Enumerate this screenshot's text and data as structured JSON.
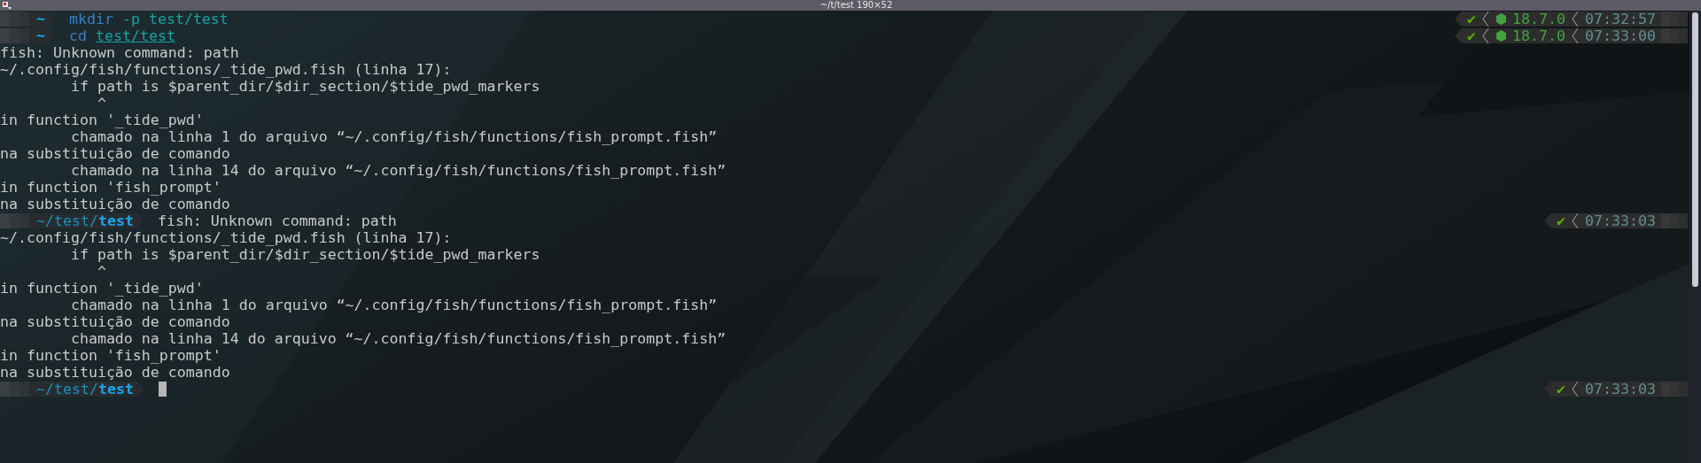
{
  "window": {
    "title": "~/t/test 190×52"
  },
  "lines": [
    {
      "kind": "prompt",
      "pwd": {
        "current": "~"
      },
      "tokens": [
        {
          "text": "mkdir",
          "kind": "command"
        },
        {
          "text": "-p test/test",
          "kind": "argument"
        }
      ],
      "right": [
        {
          "kind": "status",
          "text": "✔"
        },
        {
          "kind": "node",
          "text": "18.7.0"
        },
        {
          "kind": "time",
          "text": "07:32:57"
        }
      ],
      "cursor": false
    },
    {
      "kind": "prompt",
      "pwd": {
        "current": "~"
      },
      "tokens": [
        {
          "text": "cd",
          "kind": "command"
        },
        {
          "text": "test/test",
          "kind": "path"
        }
      ],
      "right": [
        {
          "kind": "status",
          "text": "✔"
        },
        {
          "kind": "node",
          "text": "18.7.0"
        },
        {
          "kind": "time",
          "text": "07:33:00"
        }
      ],
      "cursor": false
    },
    {
      "kind": "output",
      "text": "fish: Unknown command: path"
    },
    {
      "kind": "output",
      "text": "~/.config/fish/functions/_tide_pwd.fish (linha 17):"
    },
    {
      "kind": "output",
      "text": "        if path is $parent_dir/$dir_section/$tide_pwd_markers"
    },
    {
      "kind": "output",
      "text": "           ^"
    },
    {
      "kind": "output",
      "text": "in function '_tide_pwd'"
    },
    {
      "kind": "output",
      "text": "        chamado na linha 1 do arquivo “~/.config/fish/functions/fish_prompt.fish”"
    },
    {
      "kind": "output",
      "text": "na substituição de comando"
    },
    {
      "kind": "output",
      "text": "        chamado na linha 14 do arquivo “~/.config/fish/functions/fish_prompt.fish”"
    },
    {
      "kind": "output",
      "text": "in function 'fish_prompt'"
    },
    {
      "kind": "output",
      "text": "na substituição de comando"
    },
    {
      "kind": "prompt",
      "pwd": {
        "parent": "~/test/",
        "current": "test"
      },
      "tokens": [
        {
          "text": "fish: Unknown command: path",
          "kind": "output"
        }
      ],
      "right": [
        {
          "kind": "status",
          "text": "✔"
        },
        {
          "kind": "time",
          "text": "07:33:03"
        }
      ],
      "cursor": false
    },
    {
      "kind": "output",
      "text": "~/.config/fish/functions/_tide_pwd.fish (linha 17):"
    },
    {
      "kind": "output",
      "text": "        if path is $parent_dir/$dir_section/$tide_pwd_markers"
    },
    {
      "kind": "output",
      "text": "           ^"
    },
    {
      "kind": "output",
      "text": "in function '_tide_pwd'"
    },
    {
      "kind": "output",
      "text": "        chamado na linha 1 do arquivo “~/.config/fish/functions/fish_prompt.fish”"
    },
    {
      "kind": "output",
      "text": "na substituição de comando"
    },
    {
      "kind": "output",
      "text": "        chamado na linha 14 do arquivo “~/.config/fish/functions/fish_prompt.fish”"
    },
    {
      "kind": "output",
      "text": "in function 'fish_prompt'"
    },
    {
      "kind": "output",
      "text": "na substituição de comando"
    },
    {
      "kind": "prompt",
      "pwd": {
        "parent": "~/test/",
        "current": "test"
      },
      "right": [
        {
          "kind": "status",
          "text": "✔"
        },
        {
          "kind": "time",
          "text": "07:33:03"
        }
      ],
      "cursor": true
    }
  ]
}
